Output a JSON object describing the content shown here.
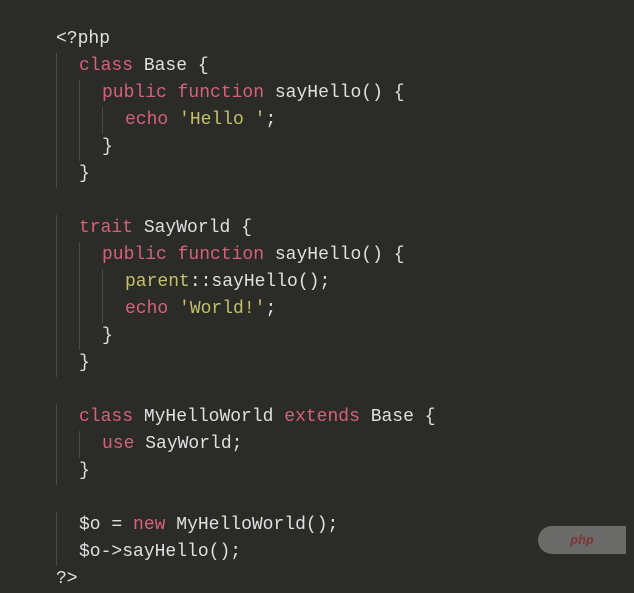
{
  "code": {
    "l1_open": "<?php",
    "l2_class": "class",
    "l2_name": "Base",
    "l2_brace": "{",
    "l3_public": "public",
    "l3_function": "function",
    "l3_name": "sayHello",
    "l3_parens": "()",
    "l3_brace": "{",
    "l4_echo": "echo",
    "l4_str": "'Hello '",
    "l4_semi": ";",
    "l5_brace": "}",
    "l6_brace": "}",
    "l8_trait": "trait",
    "l8_name": "SayWorld",
    "l8_brace": "{",
    "l9_public": "public",
    "l9_function": "function",
    "l9_name": "sayHello",
    "l9_parens": "()",
    "l9_brace": "{",
    "l10_parent": "parent",
    "l10_op": "::",
    "l10_call": "sayHello",
    "l10_parens": "()",
    "l10_semi": ";",
    "l11_echo": "echo",
    "l11_str": "'World!'",
    "l11_semi": ";",
    "l12_brace": "}",
    "l13_brace": "}",
    "l15_class": "class",
    "l15_name": "MyHelloWorld",
    "l15_extends": "extends",
    "l15_base": "Base",
    "l15_brace": "{",
    "l16_use": "use",
    "l16_name": "SayWorld",
    "l16_semi": ";",
    "l17_brace": "}",
    "l19_var": "$o",
    "l19_eq": "=",
    "l19_new": "new",
    "l19_name": "MyHelloWorld",
    "l19_parens": "()",
    "l19_semi": ";",
    "l20_var": "$o",
    "l20_arrow": "->",
    "l20_call": "sayHello",
    "l20_parens": "()",
    "l20_semi": ";",
    "l21_close": "?>"
  },
  "watermark": "php"
}
